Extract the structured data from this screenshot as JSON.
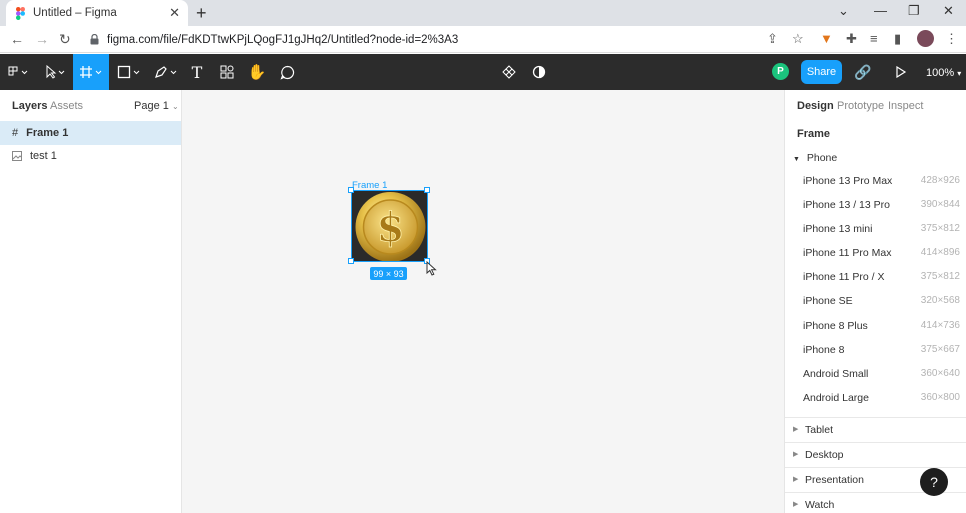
{
  "browser": {
    "tab_title": "Untitled – Figma",
    "url": "figma.com/file/FdKDTtwKPjLQogFJ1gJHq2/Untitled?node-id=2%3A3"
  },
  "toolbar": {
    "share_label": "Share",
    "zoom": "100%",
    "user_initial": "P"
  },
  "left_panel": {
    "tabs": [
      "Layers",
      "Assets"
    ],
    "page": "Page 1",
    "layers": [
      {
        "name": "Frame 1",
        "icon": "frame-icon",
        "selected": true
      },
      {
        "name": "test 1",
        "icon": "image-icon",
        "selected": false
      }
    ]
  },
  "canvas": {
    "frame_label": "Frame 1",
    "dimensions": "99 × 93"
  },
  "right_panel": {
    "tabs": [
      "Design",
      "Prototype",
      "Inspect"
    ],
    "section_title": "Frame",
    "group_open": "Phone",
    "presets": [
      {
        "name": "iPhone 13 Pro Max",
        "size": "428×926"
      },
      {
        "name": "iPhone 13 / 13 Pro",
        "size": "390×844"
      },
      {
        "name": "iPhone 13 mini",
        "size": "375×812"
      },
      {
        "name": "iPhone 11 Pro Max",
        "size": "414×896"
      },
      {
        "name": "iPhone 11 Pro / X",
        "size": "375×812"
      },
      {
        "name": "iPhone SE",
        "size": "320×568"
      },
      {
        "name": "iPhone 8 Plus",
        "size": "414×736"
      },
      {
        "name": "iPhone 8",
        "size": "375×667"
      },
      {
        "name": "Android Small",
        "size": "360×640"
      },
      {
        "name": "Android Large",
        "size": "360×800"
      }
    ],
    "groups": [
      "Tablet",
      "Desktop",
      "Presentation",
      "Watch"
    ]
  },
  "help_label": "?",
  "colors": {
    "accent": "#18a0fb",
    "toolbar_bg": "#2c2c2c",
    "canvas_bg": "#f5f5f5"
  }
}
